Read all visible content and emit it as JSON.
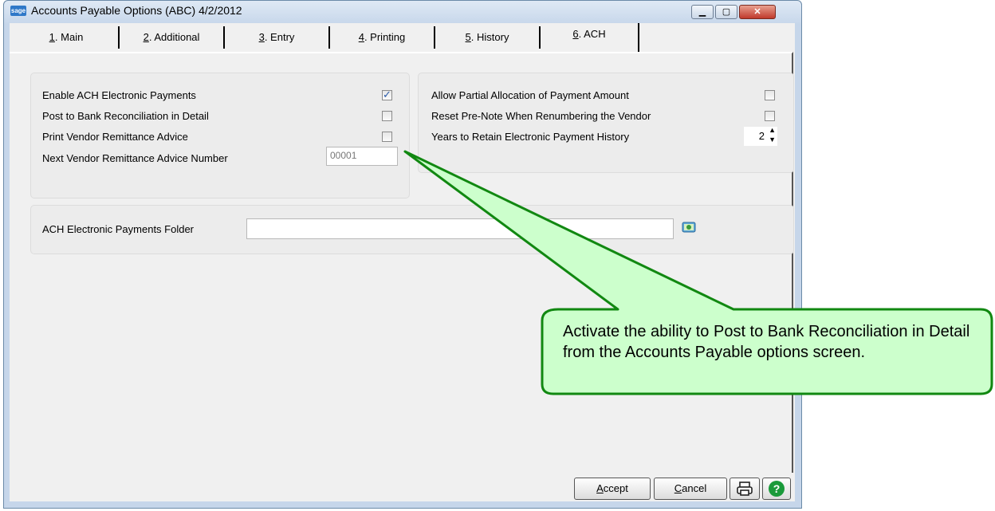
{
  "window": {
    "title": "Accounts Payable Options (ABC) 4/2/2012",
    "app_icon_text": "sage"
  },
  "tabs": [
    {
      "key": "1",
      "rest": ". Main"
    },
    {
      "key": "2",
      "rest": ". Additional"
    },
    {
      "key": "3",
      "rest": ". Entry"
    },
    {
      "key": "4",
      "rest": ". Printing"
    },
    {
      "key": "5",
      "rest": ". History"
    },
    {
      "key": "6",
      "rest": ". ACH"
    }
  ],
  "left_group": {
    "enable_ach": {
      "label": "Enable ACH Electronic Payments",
      "checked": true
    },
    "post_to_bank": {
      "label": "Post to Bank Reconciliation in Detail",
      "checked": false
    },
    "print_remittance": {
      "label": "Print Vendor Remittance Advice",
      "checked": false
    },
    "next_number": {
      "label": "Next Vendor Remittance Advice Number",
      "value": "00001"
    }
  },
  "right_group": {
    "allow_partial": {
      "label": "Allow Partial Allocation of Payment Amount",
      "checked": false
    },
    "reset_prenote": {
      "label": "Reset Pre-Note When Renumbering the Vendor",
      "checked": false
    },
    "years_retain": {
      "label": "Years to Retain Electronic Payment History",
      "value": "2"
    }
  },
  "folder": {
    "label": "ACH Electronic Payments Folder",
    "value": ""
  },
  "buttons": {
    "accept": {
      "key": "A",
      "rest": "ccept"
    },
    "cancel": {
      "key": "C",
      "rest": "ancel"
    }
  },
  "callout": {
    "text": "Activate the ability to Post to Bank Reconciliation in Detail from the Accounts Payable options screen."
  },
  "colors": {
    "callout_fill": "#ccffcc",
    "callout_stroke": "#118811",
    "checkmark": "#2a5aa8"
  }
}
